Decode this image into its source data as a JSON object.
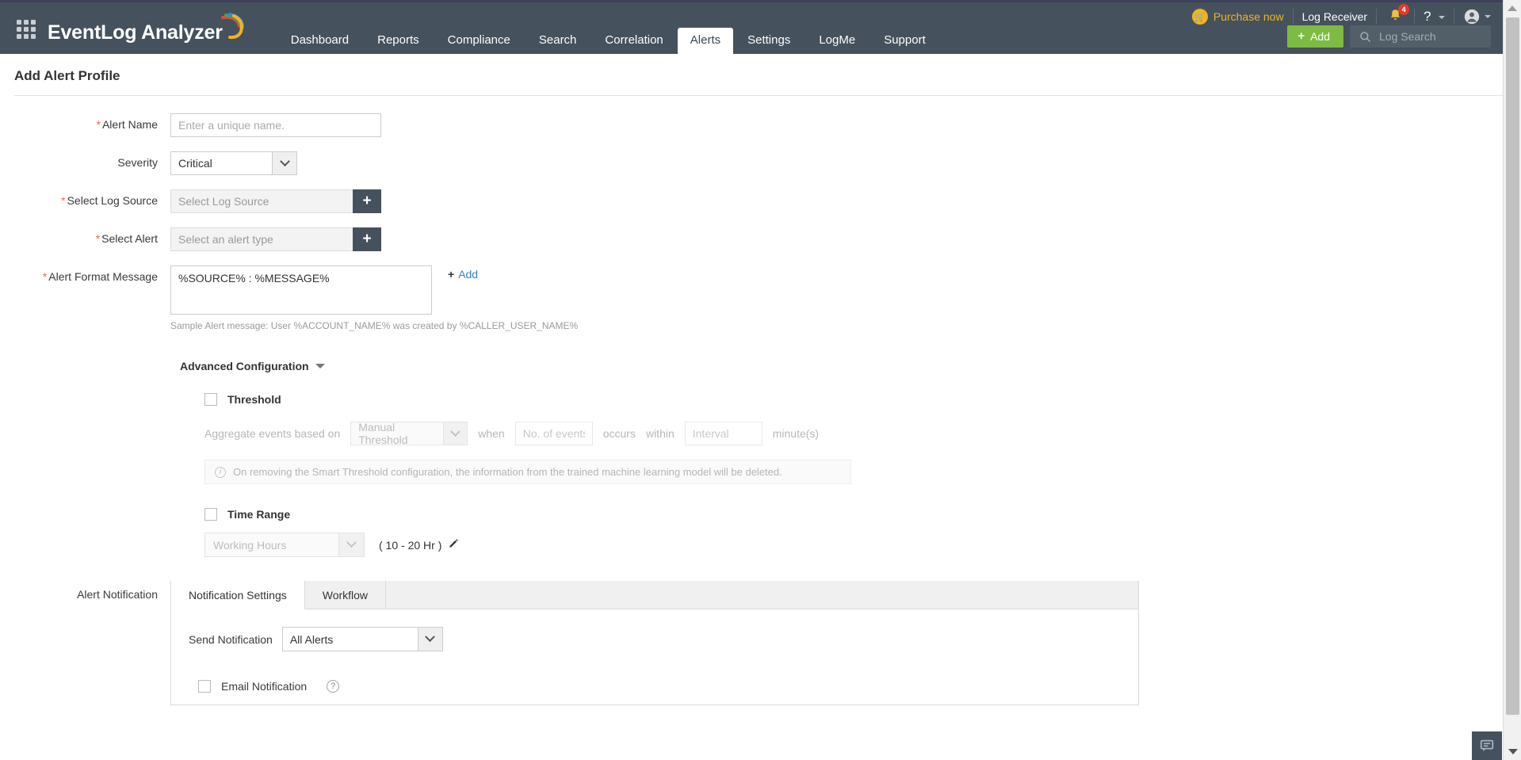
{
  "header": {
    "brand": "EventLog Analyzer",
    "apps_icon": "grid-apps-icon",
    "nav": [
      {
        "label": "Dashboard",
        "active": false
      },
      {
        "label": "Reports",
        "active": false
      },
      {
        "label": "Compliance",
        "active": false
      },
      {
        "label": "Search",
        "active": false
      },
      {
        "label": "Correlation",
        "active": false
      },
      {
        "label": "Alerts",
        "active": true
      },
      {
        "label": "Settings",
        "active": false
      },
      {
        "label": "LogMe",
        "active": false
      },
      {
        "label": "Support",
        "active": false
      }
    ],
    "purchase_now": "Purchase now",
    "log_receiver": "Log Receiver",
    "notification_count": "4",
    "help_label": "?",
    "add_button": "Add",
    "add_plus": "+",
    "log_search_placeholder": "Log Search",
    "accent_color": "#f0b323",
    "add_button_color": "#7dbb42",
    "header_color": "#45515c"
  },
  "page": {
    "title": "Add Alert Profile"
  },
  "form": {
    "alert_name": {
      "label": "Alert Name",
      "required": "*",
      "placeholder": "Enter a unique name.",
      "value": ""
    },
    "severity": {
      "label": "Severity",
      "value": "Critical"
    },
    "log_source": {
      "label": "Select Log Source",
      "required": "*",
      "placeholder": "Select Log Source",
      "add_icon": "+"
    },
    "alert_type": {
      "label": "Select Alert",
      "required": "*",
      "placeholder": "Select an alert type",
      "add_icon": "+"
    },
    "alert_format_message": {
      "label": "Alert Format Message",
      "required": "*",
      "value": "%SOURCE% : %MESSAGE%",
      "add_link": "Add",
      "add_plus": "+",
      "hint": "Sample Alert message: User %ACCOUNT_NAME% was created by %CALLER_USER_NAME%"
    },
    "advanced_configuration": {
      "label": "Advanced Configuration"
    },
    "threshold": {
      "label": "Threshold",
      "checked": false,
      "aggregate_label": "Aggregate events based on",
      "mode_value": "Manual Threshold",
      "when_label": "when",
      "events_placeholder": "No. of events",
      "occurs_label": "occurs",
      "within_label": "within",
      "interval_placeholder": "Interval",
      "minutes_label": "minute(s)",
      "note": "On removing the Smart Threshold configuration, the information from the trained machine learning model will be deleted."
    },
    "time_range": {
      "label": "Time Range",
      "checked": false,
      "value": "Working Hours",
      "hours": "( 10 - 20 Hr )",
      "edit_icon": "pencil-icon"
    },
    "alert_notification": {
      "label": "Alert Notification",
      "tabs": [
        {
          "label": "Notification Settings",
          "active": true
        },
        {
          "label": "Workflow",
          "active": false
        }
      ],
      "send_notification": {
        "label": "Send Notification",
        "value": "All Alerts"
      },
      "email_notification": {
        "label": "Email Notification",
        "checked": false,
        "help_icon": "?"
      }
    }
  },
  "feedback": {
    "icon": "chat-bubble-icon"
  }
}
